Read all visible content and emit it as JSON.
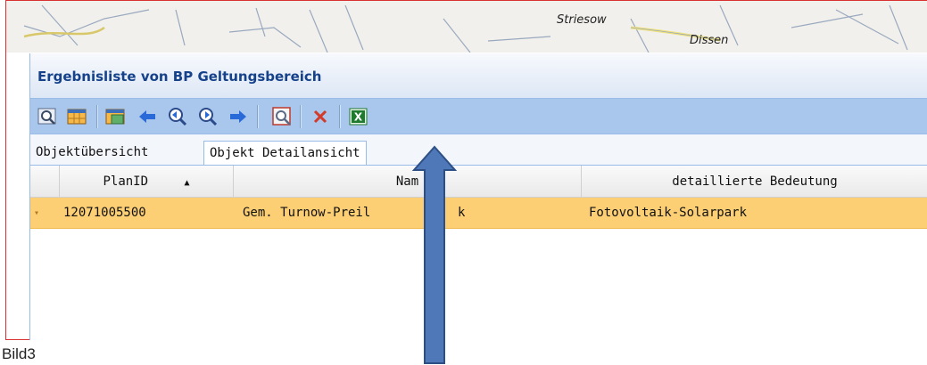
{
  "map": {
    "labels": [
      "Striesow",
      "Dissen"
    ]
  },
  "panel": {
    "title": "Ergebnisliste von BP Geltungsbereich"
  },
  "toolbar": {
    "buttons": [
      {
        "name": "zoom-to-object-icon"
      },
      {
        "name": "table-icon"
      },
      {
        "name": "map-layer-icon"
      },
      {
        "name": "arrow-left-icon"
      },
      {
        "name": "zoom-back-icon"
      },
      {
        "name": "zoom-forward-icon"
      },
      {
        "name": "arrow-right-icon"
      },
      {
        "name": "detail-view-icon"
      },
      {
        "name": "delete-icon"
      },
      {
        "name": "excel-export-icon"
      }
    ],
    "colors": {
      "delete": "#d23a2a",
      "arrows": "#2a6ad8",
      "excel": "#1e7b2e"
    }
  },
  "tabs": [
    {
      "label": "Objektübersicht",
      "active": false
    },
    {
      "label": "Objekt Detailansicht",
      "active": true
    }
  ],
  "grid": {
    "columns": [
      "PlanID",
      "Nam",
      "detaillierte Bedeutung"
    ],
    "sort_indicator": "▲",
    "rows": [
      {
        "cells": [
          "12071005500",
          "Gem. Turnow-Preil",
          "k",
          "Fotovoltaik-Solarpark"
        ],
        "selected": true
      }
    ],
    "selected_row_color": "#fdcf75"
  },
  "caption": "Bild3",
  "annotation": {
    "arrow_color": "#4f78b8"
  }
}
